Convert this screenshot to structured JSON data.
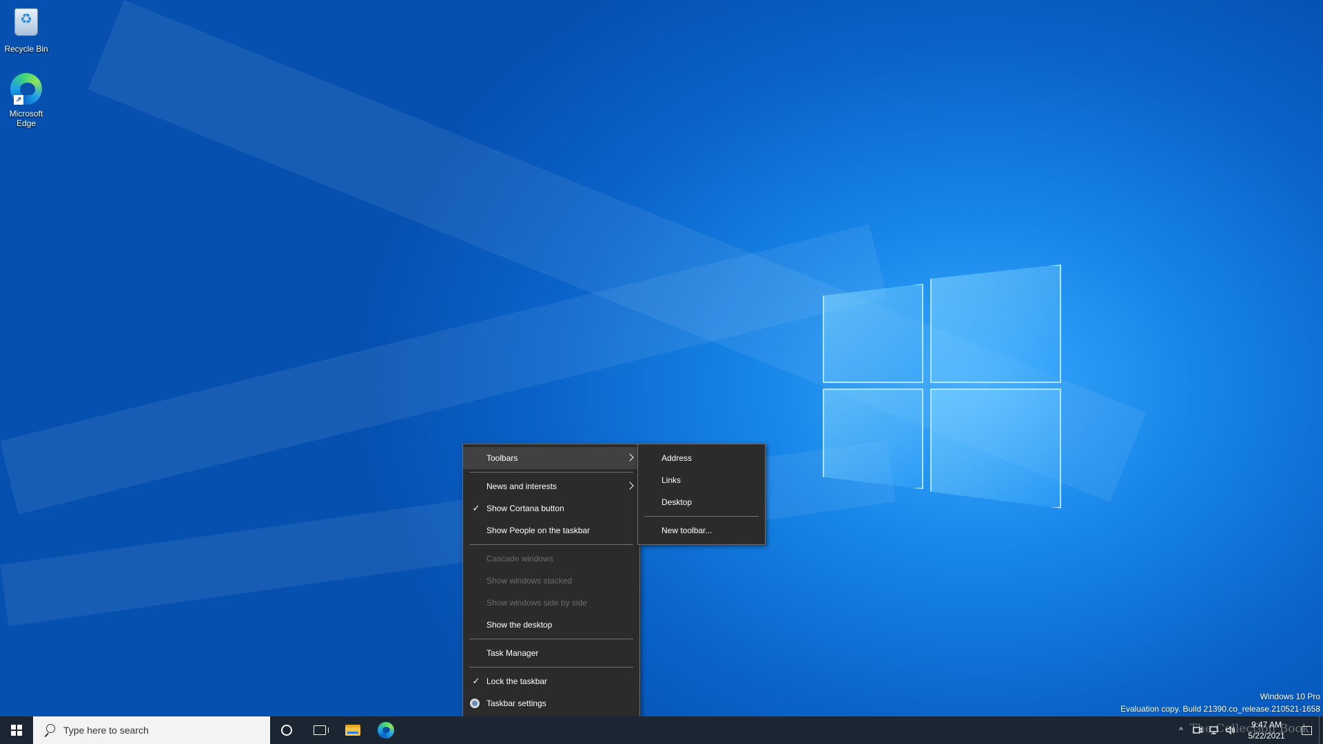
{
  "desktop": {
    "icons": [
      {
        "label": "Recycle Bin",
        "icon": "recycle-bin-icon"
      },
      {
        "label": "Microsoft Edge",
        "icon": "edge-icon"
      }
    ]
  },
  "context_menu": {
    "items": {
      "toolbars": "Toolbars",
      "news": "News and interests",
      "cortana": "Show Cortana button",
      "people": "Show People on the taskbar",
      "cascade": "Cascade windows",
      "stacked": "Show windows stacked",
      "side_by_side": "Show windows side by side",
      "desktop": "Show the desktop",
      "task_manager": "Task Manager",
      "lock": "Lock the taskbar",
      "settings": "Taskbar settings"
    },
    "check_glyph": "✓"
  },
  "toolbars_submenu": {
    "items": {
      "address": "Address",
      "links": "Links",
      "desktop": "Desktop",
      "new_toolbar": "New toolbar..."
    }
  },
  "taskbar": {
    "search_placeholder": "Type here to search",
    "tray_chevron": "^",
    "time": "9:47 AM",
    "date": "5/22/2021",
    "bg_color": "#1c2632"
  },
  "watermark": {
    "edition": "Windows 10 Pro",
    "build": "Evaluation copy. Build 21390.co_release.210521-1658"
  },
  "overlay": {
    "brand": "The Collection Book"
  }
}
